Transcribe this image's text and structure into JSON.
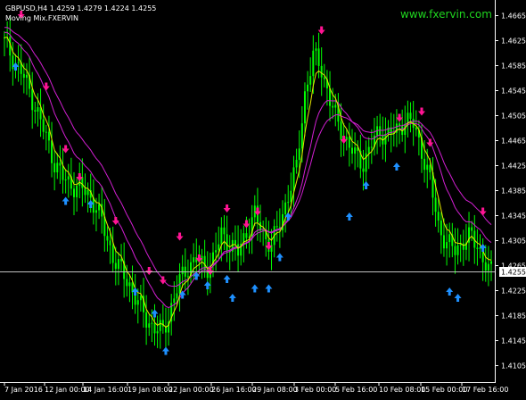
{
  "header": {
    "symbol_line": "GBPUSD,H4  1.4259 1.4279 1.4224 1.4255",
    "indicator_line": "Moving Mix.FXERVIN"
  },
  "brand": "www.fxervin.com",
  "colors": {
    "background": "#000000",
    "candle": "#00ff00",
    "ma_fast": "#e6e600",
    "ma_slow": "#d11fd1",
    "arrow_up": "#1e90ff",
    "arrow_down": "#ff1493",
    "axis_text": "#ffffff",
    "price_line": "#c0c0c0"
  },
  "current_price": "1.4255",
  "chart_data": {
    "type": "line",
    "title": "GBPUSD,H4",
    "price_axis_ticks": [
      "1.4665",
      "1.4625",
      "1.4585",
      "1.4545",
      "1.4505",
      "1.4465",
      "1.4425",
      "1.4385",
      "1.4345",
      "1.4305",
      "1.4265",
      "1.4225",
      "1.4185",
      "1.4145",
      "1.4105"
    ],
    "time_axis_ticks": [
      "7 Jan 2016",
      "12 Jan 00:00",
      "14 Jan 16:00",
      "19 Jan 08:00",
      "22 Jan 00:00",
      "26 Jan 16:00",
      "29 Jan 08:00",
      "3 Feb 00:00",
      "5 Feb 16:00",
      "10 Feb 08:00",
      "15 Feb 00:00",
      "17 Feb 16:00"
    ],
    "ylim": [
      1.408,
      1.469
    ],
    "current_price": 1.4255,
    "approx_close_path": [
      [
        0,
        1.4622
      ],
      [
        3,
        1.4598
      ],
      [
        6,
        1.4575
      ],
      [
        9,
        1.4545
      ],
      [
        12,
        1.4508
      ],
      [
        15,
        1.447
      ],
      [
        18,
        1.443
      ],
      [
        21,
        1.4405
      ],
      [
        24,
        1.4395
      ],
      [
        27,
        1.439
      ],
      [
        30,
        1.438
      ],
      [
        33,
        1.436
      ],
      [
        36,
        1.432
      ],
      [
        39,
        1.428
      ],
      [
        42,
        1.4255
      ],
      [
        45,
        1.4235
      ],
      [
        48,
        1.4205
      ],
      [
        51,
        1.418
      ],
      [
        54,
        1.4165
      ],
      [
        57,
        1.4158
      ],
      [
        60,
        1.42
      ],
      [
        63,
        1.424
      ],
      [
        66,
        1.4265
      ],
      [
        69,
        1.4275
      ],
      [
        72,
        1.426
      ],
      [
        75,
        1.4275
      ],
      [
        78,
        1.4315
      ],
      [
        81,
        1.43
      ],
      [
        84,
        1.4285
      ],
      [
        87,
        1.432
      ],
      [
        90,
        1.4345
      ],
      [
        93,
        1.4315
      ],
      [
        96,
        1.43
      ],
      [
        99,
        1.433
      ],
      [
        102,
        1.438
      ],
      [
        105,
        1.442
      ],
      [
        108,
        1.454
      ],
      [
        111,
        1.46
      ],
      [
        114,
        1.458
      ],
      [
        117,
        1.453
      ],
      [
        120,
        1.449
      ],
      [
        123,
        1.4465
      ],
      [
        126,
        1.444
      ],
      [
        129,
        1.443
      ],
      [
        132,
        1.446
      ],
      [
        135,
        1.448
      ],
      [
        138,
        1.4475
      ],
      [
        141,
        1.448
      ],
      [
        144,
        1.45
      ],
      [
        147,
        1.449
      ],
      [
        150,
        1.445
      ],
      [
        153,
        1.44
      ],
      [
        156,
        1.433
      ],
      [
        159,
        1.43
      ],
      [
        162,
        1.429
      ],
      [
        165,
        1.4305
      ],
      [
        168,
        1.431
      ],
      [
        171,
        1.429
      ],
      [
        174,
        1.4255
      ]
    ],
    "signals": {
      "buy_arrows": [
        [
          4,
          1.459
        ],
        [
          22,
          1.4375
        ],
        [
          31,
          1.437
        ],
        [
          47,
          1.423
        ],
        [
          54,
          1.4195
        ],
        [
          58,
          1.4135
        ],
        [
          64,
          1.4225
        ],
        [
          69,
          1.4255
        ],
        [
          73,
          1.424
        ],
        [
          80,
          1.425
        ],
        [
          82,
          1.422
        ],
        [
          90,
          1.4235
        ],
        [
          95,
          1.4235
        ],
        [
          99,
          1.4285
        ],
        [
          102,
          1.435
        ],
        [
          124,
          1.435
        ],
        [
          130,
          1.44
        ],
        [
          141,
          1.443
        ],
        [
          160,
          1.423
        ],
        [
          163,
          1.422
        ],
        [
          172,
          1.43
        ]
      ],
      "sell_arrows": [
        [
          6,
          1.466
        ],
        [
          15,
          1.4545
        ],
        [
          22,
          1.4445
        ],
        [
          27,
          1.44
        ],
        [
          40,
          1.433
        ],
        [
          52,
          1.425
        ],
        [
          57,
          1.4235
        ],
        [
          63,
          1.4305
        ],
        [
          70,
          1.427
        ],
        [
          74,
          1.425
        ],
        [
          80,
          1.435
        ],
        [
          87,
          1.4325
        ],
        [
          91,
          1.4345
        ],
        [
          95,
          1.429
        ],
        [
          114,
          1.4635
        ],
        [
          122,
          1.446
        ],
        [
          142,
          1.4495
        ],
        [
          150,
          1.4505
        ],
        [
          153,
          1.4455
        ],
        [
          172,
          1.4345
        ]
      ]
    }
  }
}
